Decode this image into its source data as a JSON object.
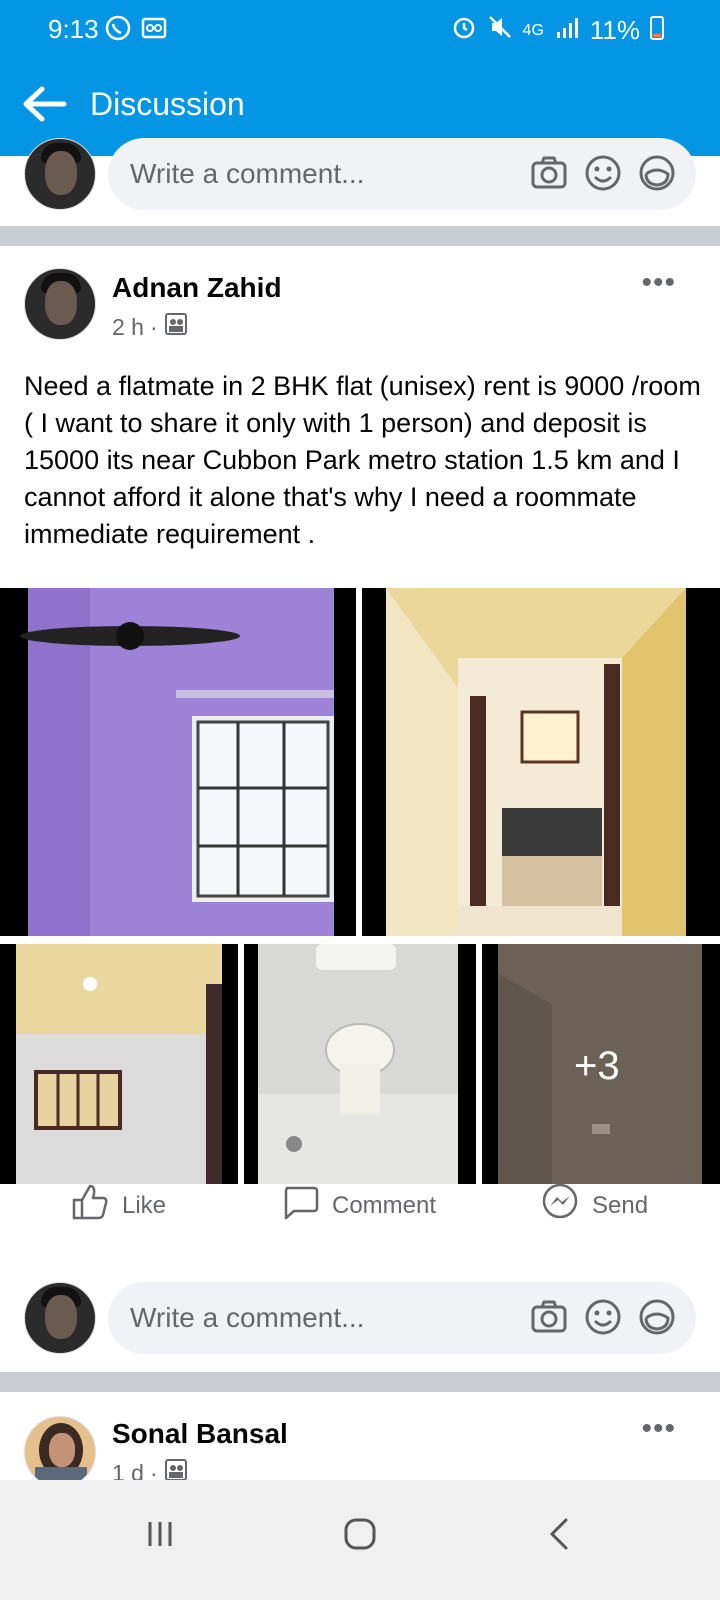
{
  "status_bar": {
    "time": "9:13",
    "battery": "11%",
    "network": "4G"
  },
  "header": {
    "title": "Discussion"
  },
  "composer": {
    "placeholder": "Write a comment..."
  },
  "post": {
    "author": "Adnan Zahid",
    "time": "2 h",
    "text": "Need a flatmate in 2 BHK flat (unisex) rent  is 9000 /room ( I want to share it only with 1 person) and deposit is 15000 its near Cubbon Park metro station 1.5 km and I cannot afford it alone that's why I need a roommate immediate requirement .",
    "more_photos": "+3",
    "actions": {
      "like": "Like",
      "comment": "Comment",
      "send": "Send"
    }
  },
  "composer2": {
    "placeholder": "Write a comment..."
  },
  "next_post": {
    "author": "Sonal Bansal",
    "time": "1 d"
  }
}
